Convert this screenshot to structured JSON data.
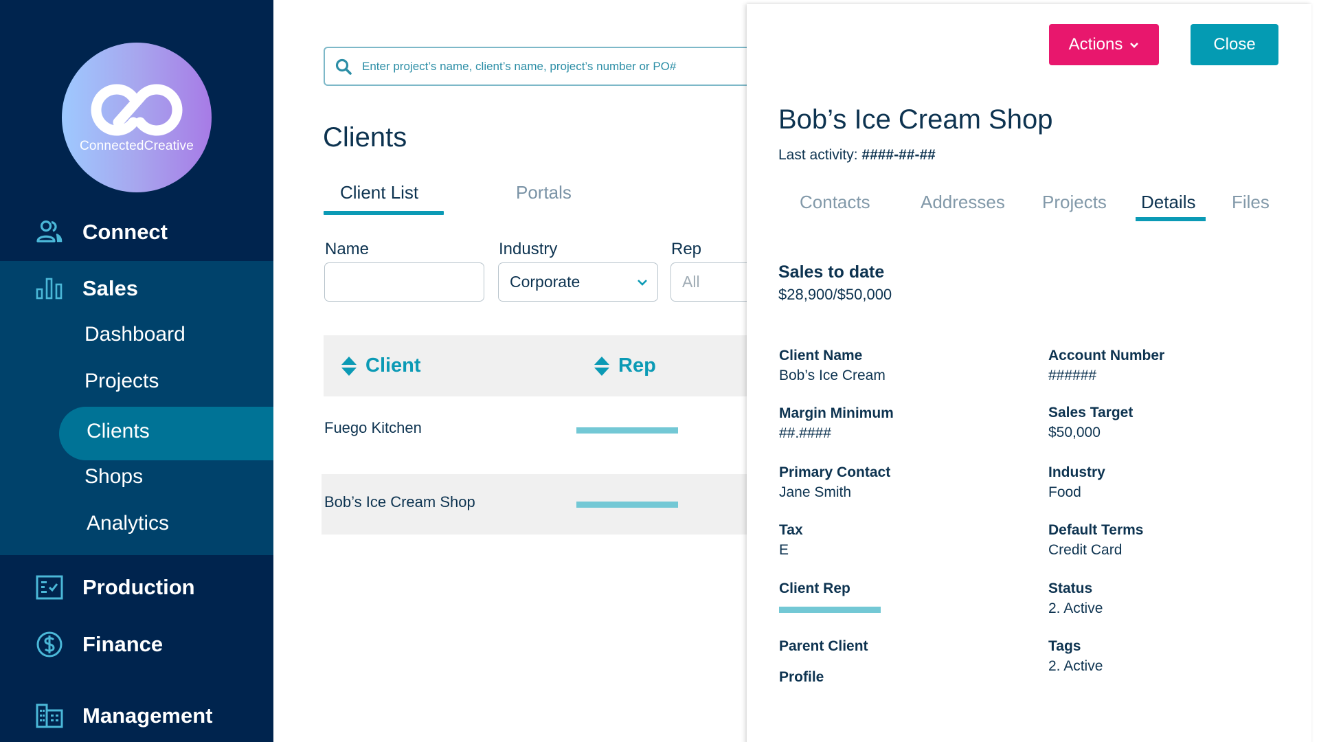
{
  "brand": {
    "logo_text": "ConnectedCreative",
    "gradient": [
      "#9ec9ff",
      "#a77be6"
    ]
  },
  "colors": {
    "sidebar_bg": "#00244e",
    "sidebar_section_bg": "#00426b",
    "sidebar_active_bg": "#007396",
    "accent_teal": "#0b9ab5",
    "accent_pink": "#e8176d",
    "text_dark": "#0d3350",
    "rep_bar": "#73c8d5"
  },
  "sidebar": {
    "sections": [
      {
        "label": "Connect",
        "icon": "people-icon"
      },
      {
        "label": "Sales",
        "icon": "bar-chart-icon",
        "expanded": true,
        "items": [
          {
            "label": "Dashboard"
          },
          {
            "label": "Projects"
          },
          {
            "label": "Clients",
            "active": true
          },
          {
            "label": "Shops"
          },
          {
            "label": "Analytics"
          }
        ]
      },
      {
        "label": "Production",
        "icon": "checklist-icon"
      },
      {
        "label": "Finance",
        "icon": "dollar-circle-icon"
      },
      {
        "label": "Management",
        "icon": "building-icon"
      }
    ]
  },
  "search": {
    "placeholder": "Enter project’s name, client’s name, project’s number or PO#",
    "value": ""
  },
  "main": {
    "title": "Clients",
    "tabs": [
      {
        "label": "Client List",
        "active": true
      },
      {
        "label": "Portals",
        "active": false
      }
    ],
    "filters": {
      "name": {
        "label": "Name",
        "value": ""
      },
      "industry": {
        "label": "Industry",
        "value": "Corporate"
      },
      "rep": {
        "label": "Rep",
        "placeholder": "All"
      }
    },
    "table": {
      "columns": [
        "Client",
        "Rep"
      ],
      "rows": [
        {
          "client": "Fuego Kitchen",
          "rep": ""
        },
        {
          "client": "Bob’s Ice Cream Shop",
          "rep": ""
        }
      ]
    }
  },
  "panel": {
    "actions_label": "Actions",
    "close_label": "Close",
    "title": "Bob’s Ice Cream Shop",
    "last_activity_label": "Last activity:",
    "last_activity_value": "####-##-##",
    "tabs": [
      {
        "label": "Contacts",
        "active": false
      },
      {
        "label": "Addresses",
        "active": false
      },
      {
        "label": "Projects",
        "active": false
      },
      {
        "label": "Details",
        "active": true
      },
      {
        "label": "Files",
        "active": false
      }
    ],
    "sales_to_date": {
      "label": "Sales to date",
      "value": "$28,900/$50,000"
    },
    "fields_left": [
      {
        "label": "Client Name",
        "value": "Bob’s Ice Cream"
      },
      {
        "label": "Margin Minimum",
        "value": "##.####"
      },
      {
        "label": "Primary Contact",
        "value": "Jane Smith"
      },
      {
        "label": "Tax",
        "value": "E"
      },
      {
        "label": "Client Rep",
        "value": ""
      },
      {
        "label": "Parent Client",
        "value": ""
      },
      {
        "label": "Profile",
        "value": ""
      }
    ],
    "fields_right": [
      {
        "label": "Account Number",
        "value": "######"
      },
      {
        "label": "Sales Target",
        "value": "$50,000"
      },
      {
        "label": "Industry",
        "value": "Food"
      },
      {
        "label": "Default Terms",
        "value": "Credit Card"
      },
      {
        "label": "Status",
        "value": "2. Active"
      },
      {
        "label": "Tags",
        "value": "2. Active"
      }
    ]
  }
}
